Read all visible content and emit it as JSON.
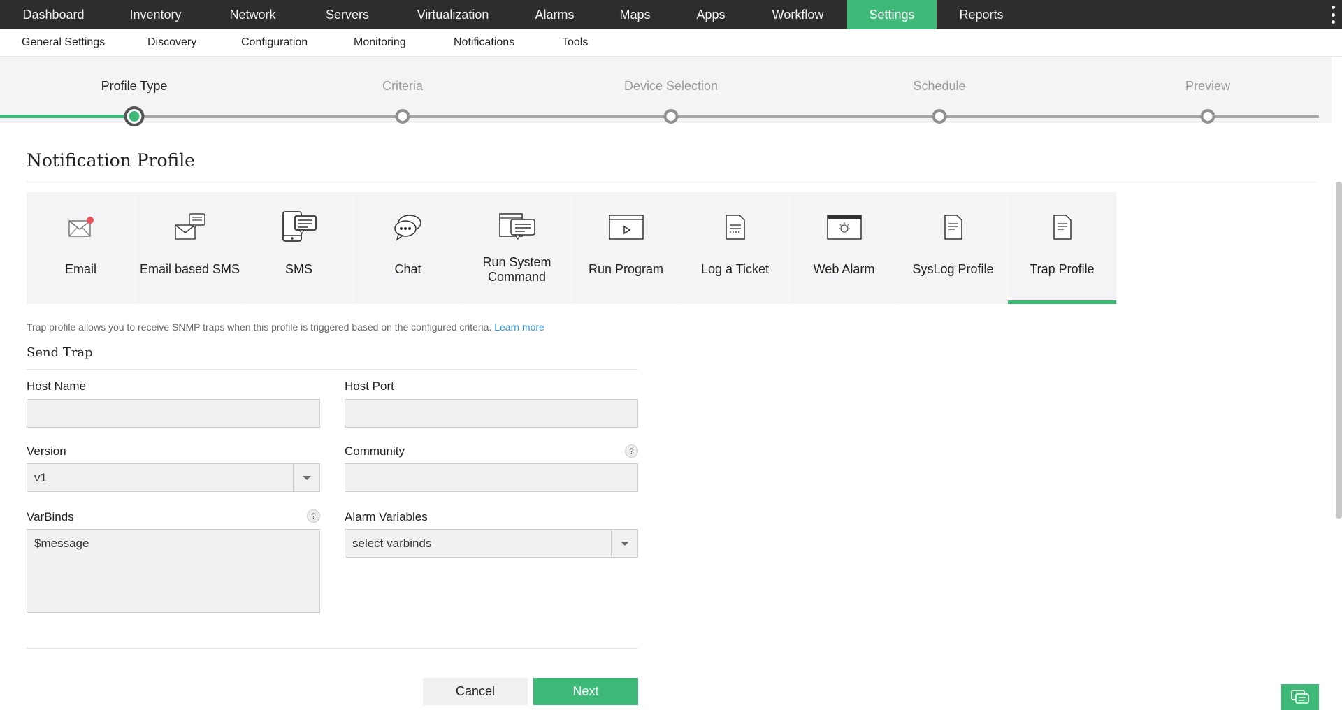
{
  "topnav": {
    "items": [
      "Dashboard",
      "Inventory",
      "Network",
      "Servers",
      "Virtualization",
      "Alarms",
      "Maps",
      "Apps",
      "Workflow",
      "Settings",
      "Reports"
    ],
    "active": "Settings"
  },
  "subnav": {
    "items": [
      "General Settings",
      "Discovery",
      "Configuration",
      "Monitoring",
      "Notifications",
      "Tools"
    ]
  },
  "stepper": {
    "steps": [
      "Profile Type",
      "Criteria",
      "Device Selection",
      "Schedule",
      "Preview"
    ],
    "current": "Profile Type"
  },
  "page_title": "Notification Profile",
  "profile_types": [
    {
      "label": "Email",
      "icon": "email-icon"
    },
    {
      "label": "Email based SMS",
      "icon": "email-sms-icon"
    },
    {
      "label": "SMS",
      "icon": "sms-icon"
    },
    {
      "label": "Chat",
      "icon": "chat-icon"
    },
    {
      "label": "Run System Command",
      "icon": "system-command-icon"
    },
    {
      "label": "Run Program",
      "icon": "run-program-icon"
    },
    {
      "label": "Log a Ticket",
      "icon": "ticket-icon"
    },
    {
      "label": "Web Alarm",
      "icon": "web-alarm-icon"
    },
    {
      "label": "SysLog Profile",
      "icon": "syslog-icon"
    },
    {
      "label": "Trap Profile",
      "icon": "trap-icon"
    }
  ],
  "selected_profile": "Trap Profile",
  "description": {
    "text": "Trap profile allows you to receive SNMP traps when this profile is triggered based on the configured criteria.",
    "link": "Learn more"
  },
  "section_title": "Send Trap",
  "form": {
    "host_name": {
      "label": "Host Name",
      "value": ""
    },
    "host_port": {
      "label": "Host Port",
      "value": ""
    },
    "version": {
      "label": "Version",
      "value": "v1"
    },
    "community": {
      "label": "Community",
      "value": ""
    },
    "varbinds": {
      "label": "VarBinds",
      "value": "$message"
    },
    "alarm_variables": {
      "label": "Alarm Variables",
      "value": "select varbinds"
    },
    "help_glyph": "?"
  },
  "buttons": {
    "cancel": "Cancel",
    "next": "Next"
  },
  "colors": {
    "accent": "#3fb978",
    "topbar": "#2d2d2d",
    "link": "#2f8fd6"
  }
}
